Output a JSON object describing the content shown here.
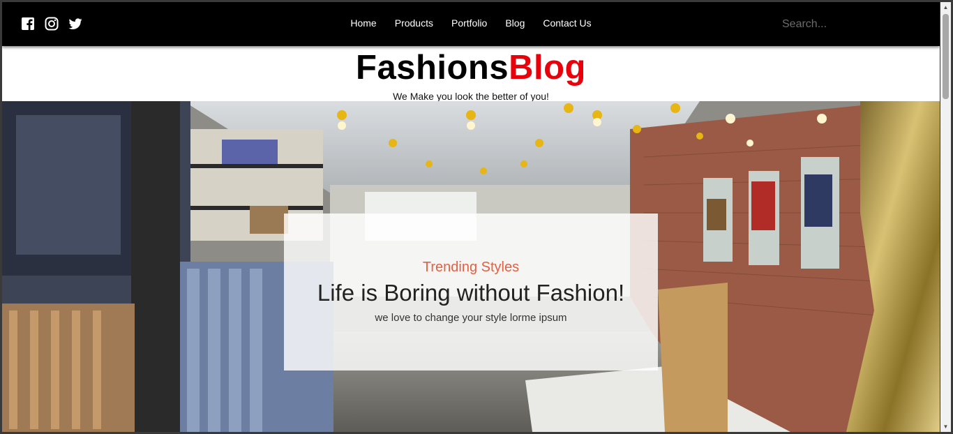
{
  "nav": {
    "social_icons": [
      "facebook-icon",
      "instagram-icon",
      "twitter-icon"
    ],
    "links": [
      "Home",
      "Products",
      "Portfolio",
      "Blog",
      "Contact Us"
    ],
    "search_placeholder": "Search..."
  },
  "brand": {
    "logo_part1": "Fashions",
    "logo_part2": "Blog",
    "logo_part2_color": "#e8000b",
    "tagline": "We Make you look the better of you!"
  },
  "hero": {
    "kicker": "Trending Styles",
    "kicker_color": "#e26043",
    "headline": "Life is Boring without Fashion!",
    "subtext": "we love to change your style lorme ipsum"
  }
}
